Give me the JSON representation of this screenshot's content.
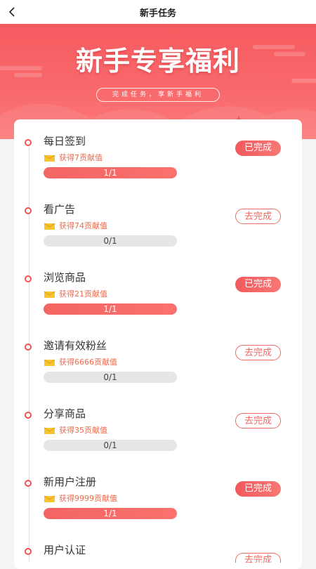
{
  "header": {
    "title": "新手任务",
    "back_icon": "chevron-left-icon"
  },
  "banner": {
    "title": "新手专享福利",
    "subtitle": "完成任务，享新手福利"
  },
  "tasks": [
    {
      "name": "每日签到",
      "reward": "获得7贡献值",
      "progress": "1/1",
      "progress_fraction": 1,
      "status": "已完成",
      "done": true
    },
    {
      "name": "看广告",
      "reward": "获得74贡献值",
      "progress": "0/1",
      "progress_fraction": 0,
      "status": "去完成",
      "done": false
    },
    {
      "name": "浏览商品",
      "reward": "获得21贡献值",
      "progress": "1/1",
      "progress_fraction": 1,
      "status": "已完成",
      "done": true
    },
    {
      "name": "邀请有效粉丝",
      "reward": "获得6666贡献值",
      "progress": "0/1",
      "progress_fraction": 0,
      "status": "去完成",
      "done": false
    },
    {
      "name": "分享商品",
      "reward": "获得35贡献值",
      "progress": "0/1",
      "progress_fraction": 0,
      "status": "去完成",
      "done": false
    },
    {
      "name": "新用户注册",
      "reward": "获得9999贡献值",
      "progress": "1/1",
      "progress_fraction": 1,
      "status": "已完成",
      "done": true
    },
    {
      "name": "用户认证",
      "reward": "",
      "progress": "",
      "progress_fraction": 0,
      "status": "去完成",
      "done": false
    }
  ],
  "colors": {
    "accent": "#f25a5d",
    "reward_text": "#f06a4c",
    "bar_track": "#e6e6e6"
  }
}
